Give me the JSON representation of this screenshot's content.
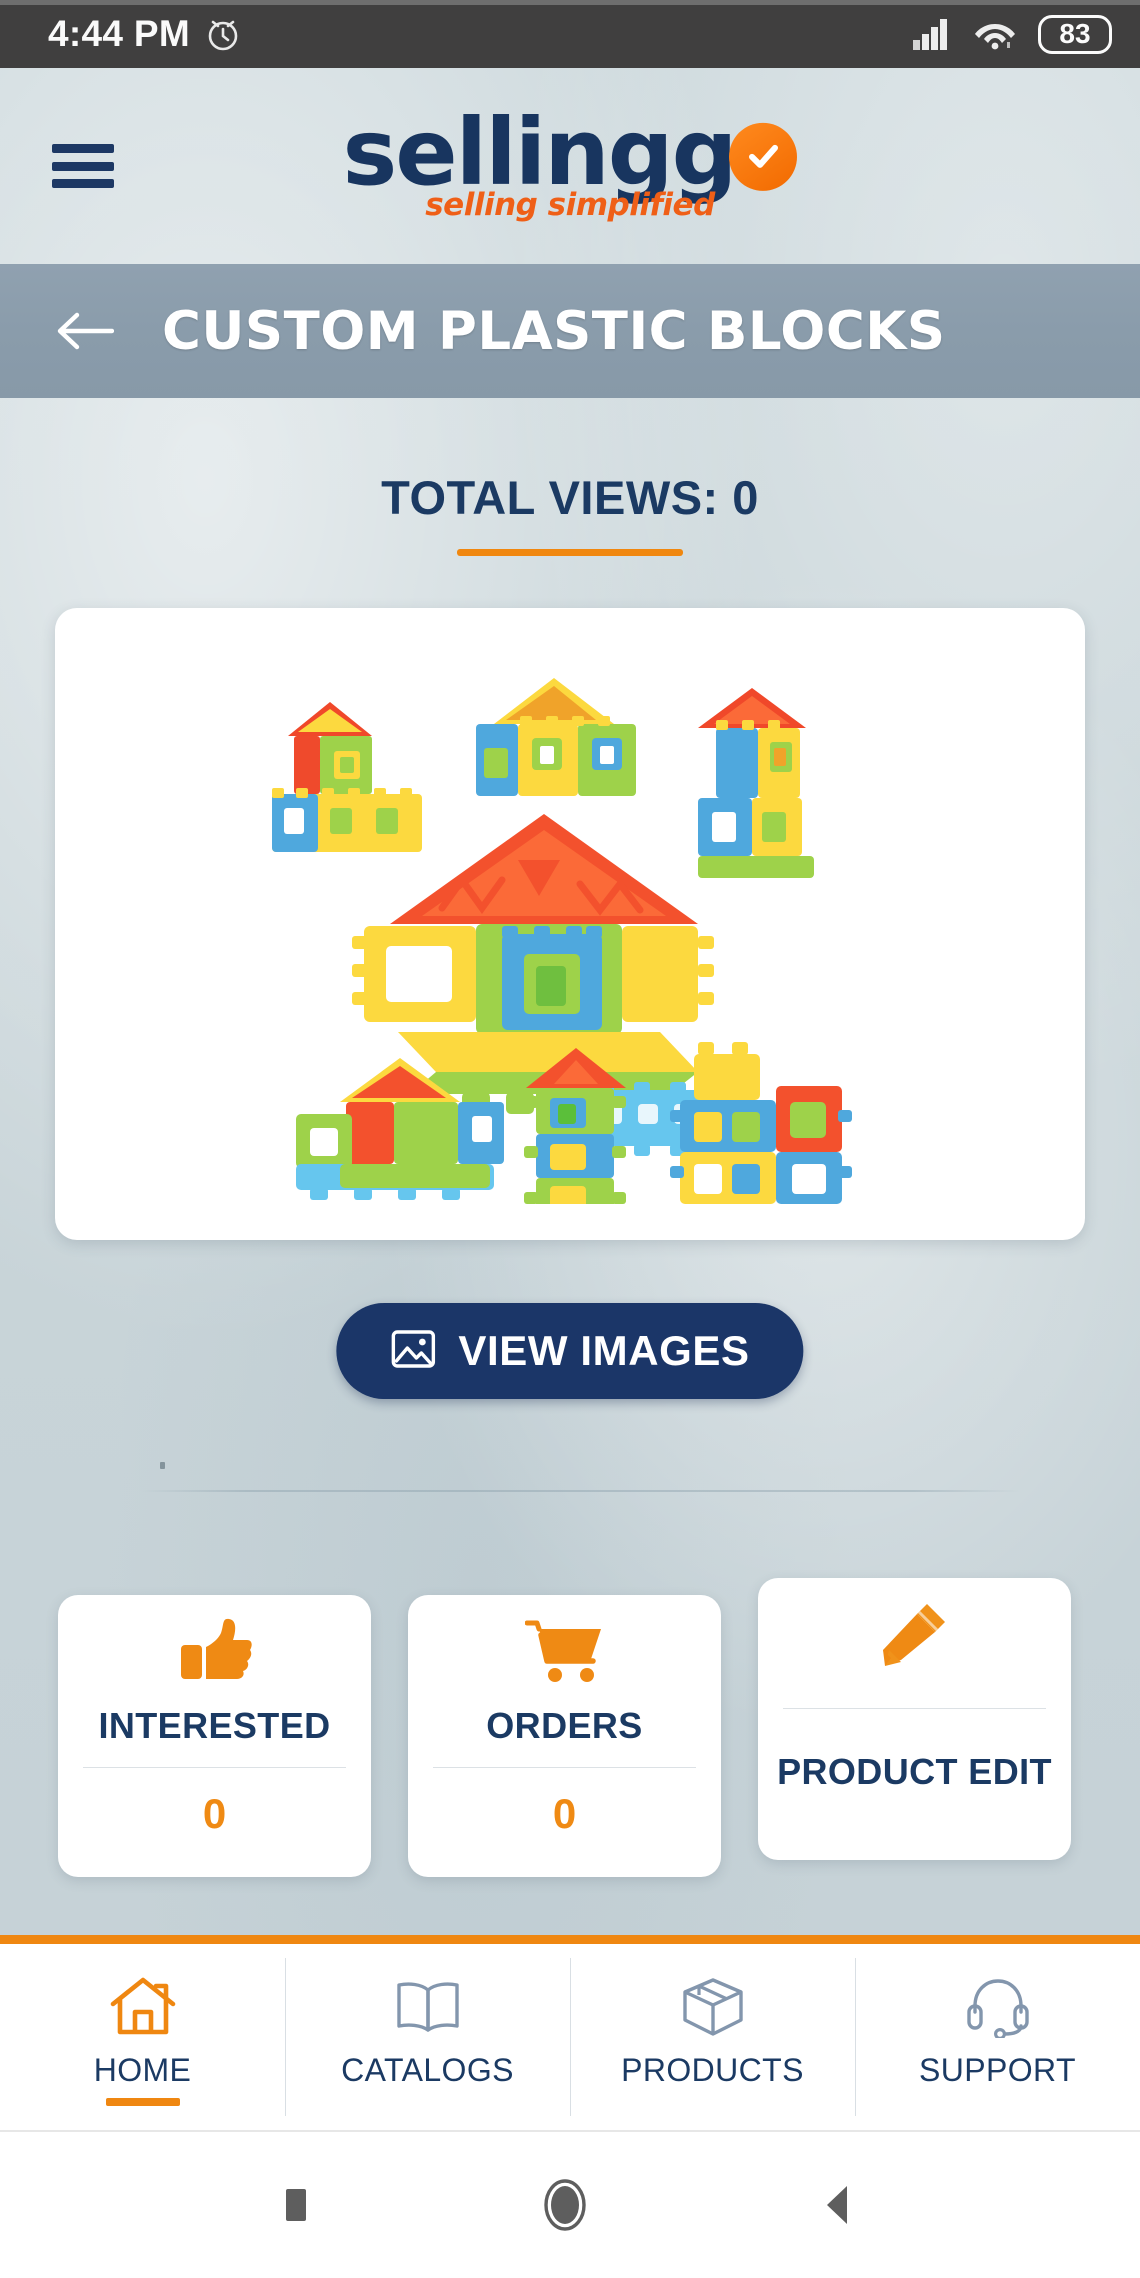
{
  "status_bar": {
    "time": "4:44 PM",
    "alarm_icon": "alarm-clock-icon",
    "signal_icon": "cellular-signal-icon",
    "wifi_icon": "wifi-icon",
    "battery_level": "83"
  },
  "header": {
    "menu_icon": "hamburger-menu-icon",
    "logo_text": "sellingo",
    "logo_text_main": "selling",
    "logo_text_suffix": "g",
    "logo_check_icon": "check-badge-icon",
    "tagline": "selling simplified"
  },
  "title_bar": {
    "back_icon": "arrow-left-icon",
    "title": "CUSTOM PLASTIC BLOCKS"
  },
  "views": {
    "label": "TOTAL VIEWS: 0",
    "count": "0"
  },
  "product": {
    "image_alt": "custom plastic building blocks toy houses",
    "view_images_label": "VIEW IMAGES",
    "view_images_icon": "image-icon"
  },
  "stats": [
    {
      "id": "interested",
      "icon": "thumbs-up-icon",
      "label": "INTERESTED",
      "count": "0"
    },
    {
      "id": "orders",
      "icon": "shopping-cart-icon",
      "label": "ORDERS",
      "count": "0"
    },
    {
      "id": "product-edit",
      "icon": "pencil-edit-icon",
      "label": "PRODUCT EDIT",
      "count": ""
    }
  ],
  "bottom_nav": [
    {
      "id": "home",
      "icon": "home-icon",
      "label": "HOME",
      "active": true
    },
    {
      "id": "catalogs",
      "icon": "book-icon",
      "label": "CATALOGS",
      "active": false
    },
    {
      "id": "products",
      "icon": "box-icon",
      "label": "PRODUCTS",
      "active": false
    },
    {
      "id": "support",
      "icon": "headset-icon",
      "label": "SUPPORT",
      "active": false
    }
  ],
  "android_nav": {
    "recents_icon": "square-recents-icon",
    "home_icon": "circle-home-icon",
    "back_icon": "triangle-back-icon"
  },
  "colors": {
    "brand_navy": "#18355f",
    "brand_orange": "#ef8711",
    "title_bar": "#8a9cab",
    "page_background": "#c9d5d9",
    "button_navy": "#1b3668",
    "status_bar": "#403f3f"
  }
}
